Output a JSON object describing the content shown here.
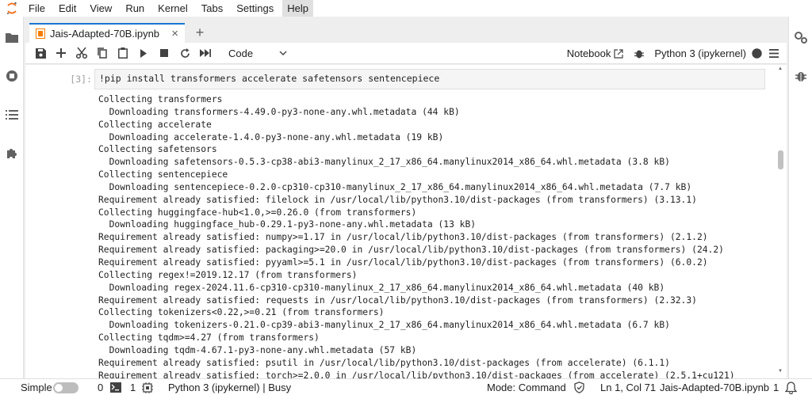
{
  "menu": [
    "File",
    "Edit",
    "View",
    "Run",
    "Kernel",
    "Tabs",
    "Settings",
    "Help"
  ],
  "tab": {
    "title": "Jais-Adapted-70B.ipynb",
    "close": "×",
    "new": "+"
  },
  "toolbar": {
    "cell_type": "Code",
    "notebook_label": "Notebook",
    "kernel": "Python 3 (ipykernel)"
  },
  "cell": {
    "prompt": "[3]:",
    "input": "!pip install transformers accelerate safetensors sentencepiece",
    "output": [
      "Collecting transformers",
      "  Downloading transformers-4.49.0-py3-none-any.whl.metadata (44 kB)",
      "Collecting accelerate",
      "  Downloading accelerate-1.4.0-py3-none-any.whl.metadata (19 kB)",
      "Collecting safetensors",
      "  Downloading safetensors-0.5.3-cp38-abi3-manylinux_2_17_x86_64.manylinux2014_x86_64.whl.metadata (3.8 kB)",
      "Collecting sentencepiece",
      "  Downloading sentencepiece-0.2.0-cp310-cp310-manylinux_2_17_x86_64.manylinux2014_x86_64.whl.metadata (7.7 kB)",
      "Requirement already satisfied: filelock in /usr/local/lib/python3.10/dist-packages (from transformers) (3.13.1)",
      "Collecting huggingface-hub<1.0,>=0.26.0 (from transformers)",
      "  Downloading huggingface_hub-0.29.1-py3-none-any.whl.metadata (13 kB)",
      "Requirement already satisfied: numpy>=1.17 in /usr/local/lib/python3.10/dist-packages (from transformers) (2.1.2)",
      "Requirement already satisfied: packaging>=20.0 in /usr/local/lib/python3.10/dist-packages (from transformers) (24.2)",
      "Requirement already satisfied: pyyaml>=5.1 in /usr/local/lib/python3.10/dist-packages (from transformers) (6.0.2)",
      "Collecting regex!=2019.12.17 (from transformers)",
      "  Downloading regex-2024.11.6-cp310-cp310-manylinux_2_17_x86_64.manylinux2014_x86_64.whl.metadata (40 kB)",
      "Requirement already satisfied: requests in /usr/local/lib/python3.10/dist-packages (from transformers) (2.32.3)",
      "Collecting tokenizers<0.22,>=0.21 (from transformers)",
      "  Downloading tokenizers-0.21.0-cp39-abi3-manylinux_2_17_x86_64.manylinux2014_x86_64.whl.metadata (6.7 kB)",
      "Collecting tqdm>=4.27 (from transformers)",
      "  Downloading tqdm-4.67.1-py3-none-any.whl.metadata (57 kB)",
      "Requirement already satisfied: psutil in /usr/local/lib/python3.10/dist-packages (from accelerate) (6.1.1)",
      "Requirement already satisfied: torch>=2.0.0 in /usr/local/lib/python3.10/dist-packages (from accelerate) (2.5.1+cu121)"
    ]
  },
  "status": {
    "mode_label": "Simple",
    "terminals": "0",
    "kernels": "1",
    "kernel_status": "Python 3 (ipykernel) | Busy",
    "command_mode": "Mode: Command",
    "cursor": "Ln 1, Col 71",
    "filename": "Jais-Adapted-70B.ipynb",
    "notifications": "1"
  },
  "colors": {
    "accent": "#1976d2",
    "tab_icon": "#f57c00",
    "jupyter_orange": "#f37726"
  }
}
